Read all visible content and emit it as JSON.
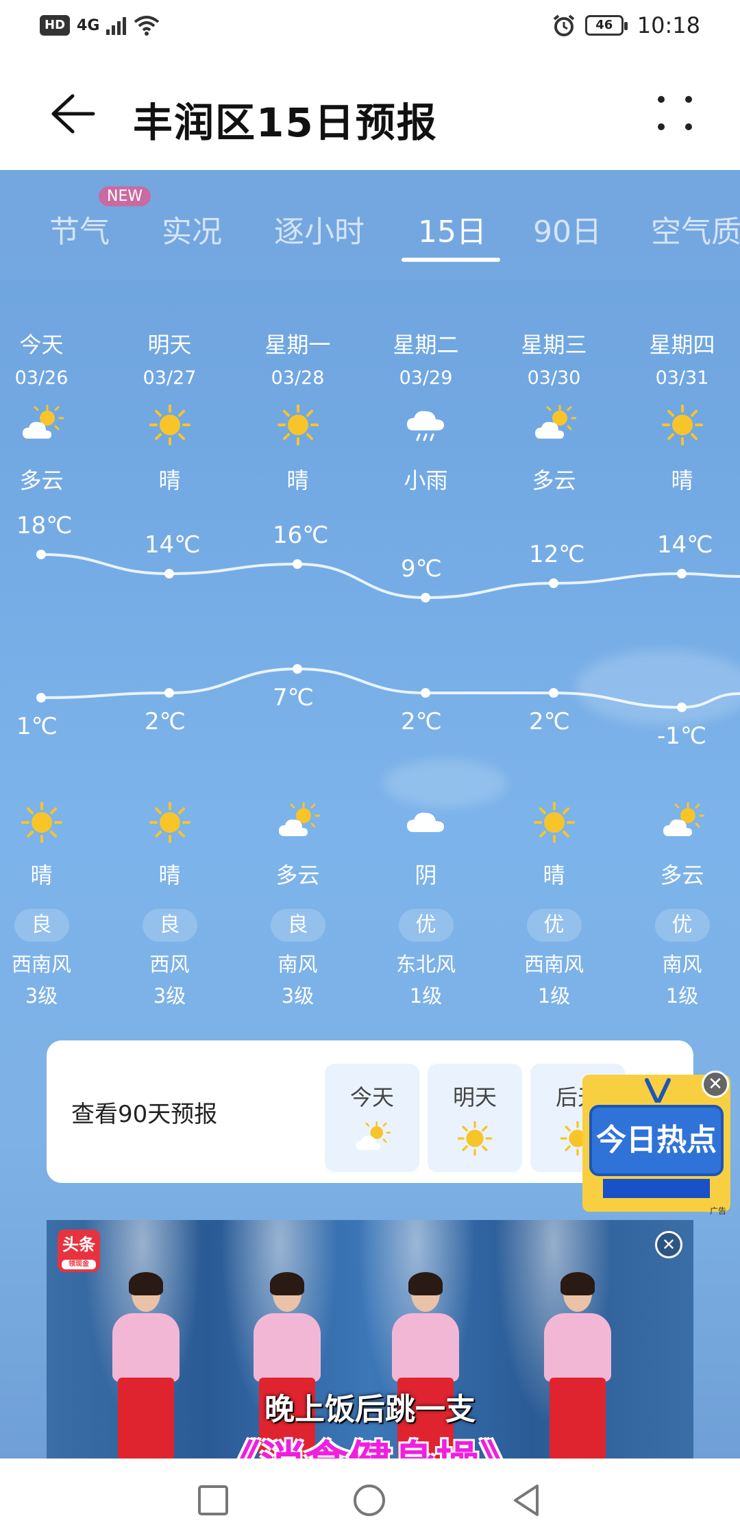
{
  "status_bar": {
    "hd": "HD",
    "network": "4G",
    "battery": "46",
    "time": "10:18"
  },
  "header": {
    "title": "丰润区15日预报"
  },
  "tabs": [
    {
      "label": "节气",
      "active": false
    },
    {
      "label": "实况",
      "active": false
    },
    {
      "label": "逐小时",
      "active": false
    },
    {
      "label": "15日",
      "active": true
    },
    {
      "label": "90日",
      "active": false
    },
    {
      "label": "空气质"
    }
  ],
  "new_badge": "NEW",
  "days": [
    {
      "name": "今天",
      "date": "03/26",
      "day_icon": "partly-cloudy-icon",
      "day_cond": "多云",
      "high": "18℃",
      "low": "1℃",
      "night_icon": "sun-icon",
      "night_cond": "晴",
      "aqi": "良",
      "wind": "西南风",
      "level": "3级"
    },
    {
      "name": "明天",
      "date": "03/27",
      "day_icon": "sun-icon",
      "day_cond": "晴",
      "high": "14℃",
      "low": "2℃",
      "night_icon": "sun-icon",
      "night_cond": "晴",
      "aqi": "良",
      "wind": "西风",
      "level": "3级"
    },
    {
      "name": "星期一",
      "date": "03/28",
      "day_icon": "sun-icon",
      "day_cond": "晴",
      "high": "16℃",
      "low": "7℃",
      "night_icon": "partly-cloudy-icon",
      "night_cond": "多云",
      "aqi": "良",
      "wind": "南风",
      "level": "3级"
    },
    {
      "name": "星期二",
      "date": "03/29",
      "day_icon": "rain-icon",
      "day_cond": "小雨",
      "high": "9℃",
      "low": "2℃",
      "night_icon": "cloud-icon",
      "night_cond": "阴",
      "aqi": "优",
      "wind": "东北风",
      "level": "1级"
    },
    {
      "name": "星期三",
      "date": "03/30",
      "day_icon": "partly-cloudy-icon",
      "day_cond": "多云",
      "high": "12℃",
      "low": "2℃",
      "night_icon": "sun-icon",
      "night_cond": "晴",
      "aqi": "优",
      "wind": "西南风",
      "level": "1级"
    },
    {
      "name": "星期四",
      "date": "03/31",
      "day_icon": "sun-icon",
      "day_cond": "晴",
      "high": "14℃",
      "low": "-1℃",
      "night_icon": "partly-cloudy-icon",
      "night_cond": "多云",
      "aqi": "优",
      "wind": "南风",
      "level": "1级"
    }
  ],
  "temps": {
    "highs": [
      18,
      14,
      16,
      9,
      12,
      14
    ],
    "lows": [
      1,
      2,
      7,
      2,
      2,
      -1
    ]
  },
  "card90": {
    "title": "查看90天预报",
    "days": [
      {
        "label": "今天",
        "icon": "partly-cloudy-icon"
      },
      {
        "label": "明天",
        "icon": "sun-icon"
      },
      {
        "label": "后天",
        "icon": "sun-icon"
      }
    ]
  },
  "float_ad": {
    "text": "今日热点",
    "tag": "广告"
  },
  "banner": {
    "logo": "头条",
    "logo_sub": "领现金",
    "line1": "晚上饭后跳一支",
    "line2": "《消食健身操》"
  },
  "colors": {
    "sky_top": "#6fa4dd",
    "sky_bottom": "#6f9fd6",
    "sun": "#f7c52a",
    "curve": "#ffffff"
  }
}
